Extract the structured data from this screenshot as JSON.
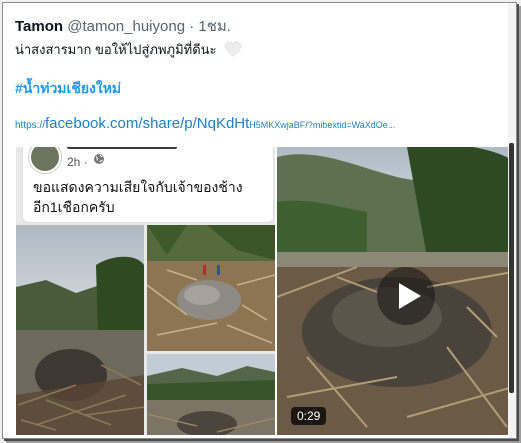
{
  "tweet": {
    "display_name": "Tamon",
    "handle": "@tamon_huiyong",
    "separator": "·",
    "time": "1ชม.",
    "text": "น่าสงสารมาก ขอให้ไปสู่ภพภูมิที่ดีนะ",
    "hashtag": "#น้ำท่วมเชียงใหม่",
    "link": {
      "protocol": "https://",
      "main": "facebook.com/share/p/NqKdHt",
      "tail": "H5MKXwjaBF/?mibextid=WaXdOe..."
    }
  },
  "media": {
    "fb_post": {
      "time": "2h",
      "dot": "·",
      "text": "ขอแสดงความเสียใจกับเจ้าของช้าง อีก1เชือกครับ"
    },
    "video": {
      "duration": "0:29"
    }
  },
  "colors": {
    "link": "#1d9bf0",
    "text": "#0f1419",
    "muted": "#536471"
  },
  "icons": [
    "heart-icon",
    "globe-icon",
    "play-icon"
  ]
}
